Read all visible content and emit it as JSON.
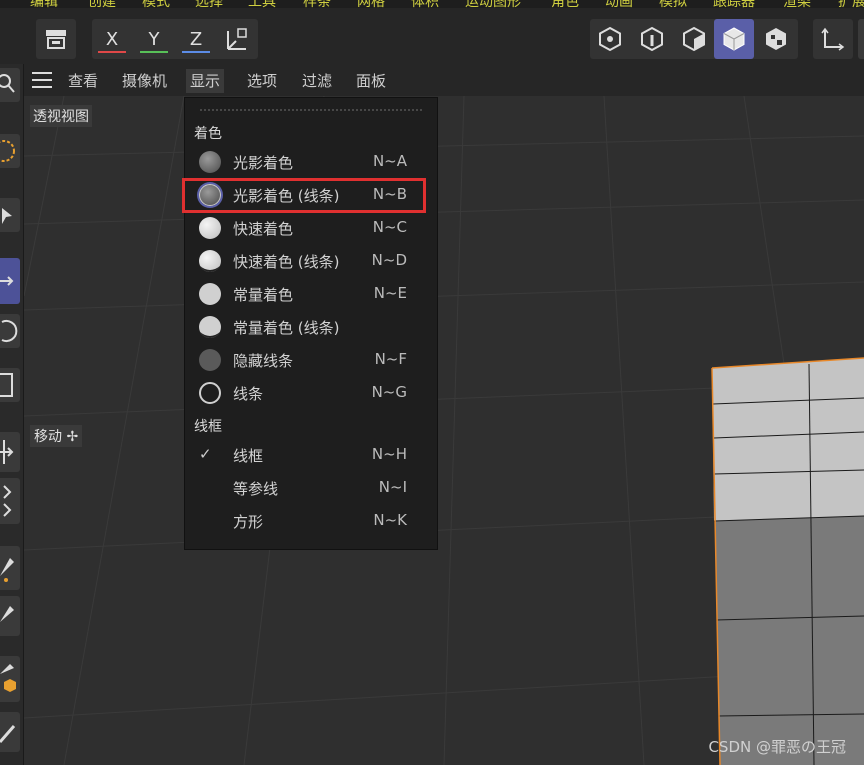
{
  "top_menu": [
    "编辑",
    "创建",
    "模式",
    "选择",
    "工具",
    "样条",
    "网格",
    "体积",
    "运动图形",
    "角色",
    "动画",
    "模拟",
    "跟踪器",
    "渲染",
    "扩展"
  ],
  "toolbar": {
    "axes": [
      {
        "label": "X",
        "color": "#e04848"
      },
      {
        "label": "Y",
        "color": "#58c058"
      },
      {
        "label": "Z",
        "color": "#5c8ce6"
      }
    ]
  },
  "viewport_menu": {
    "items": [
      "查看",
      "摄像机",
      "显示",
      "选项",
      "过滤",
      "面板"
    ],
    "open": "显示"
  },
  "view_label": "透视视图",
  "move_tip": "移动",
  "dropdown": {
    "section_shading": "着色",
    "shading_items": [
      {
        "label": "光影着色",
        "shortcut": "N~A",
        "icon": "gouraud-shading-icon"
      },
      {
        "label": "光影着色 (线条)",
        "shortcut": "N~B",
        "icon": "gouraud-lines-shading-icon",
        "selected": true
      },
      {
        "label": "快速着色",
        "shortcut": "N~C",
        "icon": "quick-shading-icon"
      },
      {
        "label": "快速着色 (线条)",
        "shortcut": "N~D",
        "icon": "quick-lines-shading-icon"
      },
      {
        "label": "常量着色",
        "shortcut": "N~E",
        "icon": "constant-shading-icon"
      },
      {
        "label": "常量着色 (线条)",
        "shortcut": "",
        "icon": "constant-lines-shading-icon"
      },
      {
        "label": "隐藏线条",
        "shortcut": "N~F",
        "icon": "hidden-line-icon"
      },
      {
        "label": "线条",
        "shortcut": "N~G",
        "icon": "lines-icon"
      }
    ],
    "section_wire": "线框",
    "wire_items": [
      {
        "label": "线框",
        "shortcut": "N~H",
        "checked": true
      },
      {
        "label": "等参线",
        "shortcut": "N~I",
        "checked": false
      },
      {
        "label": "方形",
        "shortcut": "N~K",
        "checked": false
      }
    ]
  },
  "watermark": "CSDN @罪恶の王冠",
  "colors": {
    "accent": "#5a5fa8",
    "highlight_box": "#e03030",
    "object_outline": "#e8882a"
  }
}
